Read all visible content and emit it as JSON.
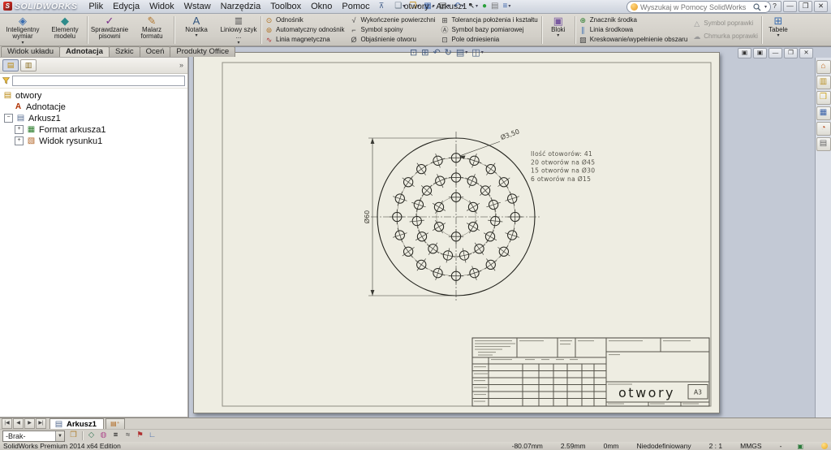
{
  "window": {
    "logo_text": "SOLIDWORKS",
    "logo_mark": "S",
    "title": "otwory - Arkusz1 *",
    "controls": [
      {
        "name": "help-button",
        "glyph": "?"
      },
      {
        "name": "minimize-button",
        "glyph": "—"
      },
      {
        "name": "restore-button",
        "glyph": "❐"
      },
      {
        "name": "close-button",
        "glyph": "✕"
      }
    ]
  },
  "menubar": {
    "items": [
      {
        "name": "plik",
        "label": "Plik"
      },
      {
        "name": "edycja",
        "label": "Edycja"
      },
      {
        "name": "widok",
        "label": "Widok"
      },
      {
        "name": "wstaw",
        "label": "Wstaw"
      },
      {
        "name": "narzedzia",
        "label": "Narzędzia"
      },
      {
        "name": "toolbox",
        "label": "Toolbox"
      },
      {
        "name": "okno",
        "label": "Okno"
      },
      {
        "name": "pomoc",
        "label": "Pomoc"
      }
    ]
  },
  "quick_access": {
    "icons": [
      {
        "name": "new-document",
        "glyph": "❏",
        "color": "#5a6a7a",
        "caret": true
      },
      {
        "name": "open-document",
        "glyph": "❒",
        "color": "#c9921f",
        "caret": true
      },
      {
        "name": "save-document",
        "glyph": "▦",
        "color": "#3a62a8",
        "caret": true
      },
      {
        "name": "print-document",
        "glyph": "▤",
        "color": "#555555",
        "caret": true
      },
      {
        "name": "undo",
        "glyph": "↶",
        "color": "#3a62a8",
        "caret": true
      },
      {
        "name": "select-arrow",
        "glyph": "↖",
        "color": "#222222",
        "caret": true
      },
      {
        "name": "rebuild",
        "glyph": "●",
        "color": "#2aa03a",
        "caret": false
      },
      {
        "name": "file-properties",
        "glyph": "▤",
        "color": "#777777",
        "caret": false
      },
      {
        "name": "options-list",
        "glyph": "≡",
        "color": "#3a62a8",
        "caret": true
      }
    ]
  },
  "search": {
    "placeholder": "Wyszukaj w Pomocy SolidWorks"
  },
  "ribbon": {
    "groups": [
      {
        "type": "big",
        "items": [
          {
            "name": "inteligentny-wymiar",
            "label": "Inteligentny wymiar",
            "glyph": "◈",
            "color": "#3a6db0",
            "caret": true
          },
          {
            "name": "elementy-modelu",
            "label": "Elementy modelu",
            "glyph": "◆",
            "color": "#2e8b8b",
            "caret": false
          }
        ]
      },
      {
        "type": "sep"
      },
      {
        "type": "big",
        "items": [
          {
            "name": "sprawdzanie-pisowni",
            "label": "Sprawdzanie pisowni",
            "glyph": "✓",
            "color": "#7a2e8b",
            "caret": false
          },
          {
            "name": "malarz-formatu",
            "label": "Malarz formatu",
            "glyph": "✎",
            "color": "#b0762e",
            "caret": false
          }
        ]
      },
      {
        "type": "sep"
      },
      {
        "type": "big",
        "items": [
          {
            "name": "notatka",
            "label": "Notatka",
            "glyph": "A",
            "color": "#33557f",
            "caret": true
          },
          {
            "name": "liniowy-szyk",
            "label": "Liniowy szyk ...",
            "glyph": "≣",
            "color": "#555555",
            "caret": true
          }
        ]
      },
      {
        "type": "sep"
      },
      {
        "type": "list",
        "items": [
          {
            "name": "odnosnik",
            "label": "Odnośnik",
            "glyph": "⊙",
            "color": "#b07020"
          },
          {
            "name": "automatyczny-odnosnik",
            "label": "Automatyczny odnośnik",
            "glyph": "⊚",
            "color": "#b07020"
          },
          {
            "name": "linia-magnetyczna",
            "label": "Linia magnetyczna",
            "glyph": "∿",
            "color": "#b03030"
          }
        ]
      },
      {
        "type": "list",
        "items": [
          {
            "name": "wykonczenie-powierzchni",
            "label": "Wykończenie powierzchni",
            "glyph": "√",
            "color": "#444444"
          },
          {
            "name": "symbol-spoiny",
            "label": "Symbol spoiny",
            "glyph": "⌐",
            "color": "#444444"
          },
          {
            "name": "objasnienie-otworu",
            "label": "Objaśnienie otworu",
            "glyph": "Ø",
            "color": "#444444"
          }
        ]
      },
      {
        "type": "list",
        "items": [
          {
            "name": "tolerancja-polozenia-i-ksztaltu",
            "label": "Tolerancja położenia i kształtu",
            "glyph": "⊞",
            "color": "#444444"
          },
          {
            "name": "symbol-bazy-pomiarowej",
            "label": "Symbol bazy pomiarowej",
            "glyph": "Ⓐ",
            "color": "#444444"
          },
          {
            "name": "pole-odniesienia",
            "label": "Pole odniesienia",
            "glyph": "⊡",
            "color": "#444444"
          }
        ]
      },
      {
        "type": "sep"
      },
      {
        "type": "big",
        "narrow": true,
        "items": [
          {
            "name": "bloki",
            "label": "Bloki",
            "glyph": "▣",
            "color": "#7a5aa0",
            "caret": true
          }
        ]
      },
      {
        "type": "sep"
      },
      {
        "type": "list",
        "items": [
          {
            "name": "znacznik-srodka",
            "label": "Znacznik środka",
            "glyph": "⊕",
            "color": "#2d7d2d"
          },
          {
            "name": "linia-srodkowa",
            "label": "Linia środkowa",
            "glyph": "∥",
            "color": "#3a6db0"
          },
          {
            "name": "kreskowanie-wypelnienie",
            "label": "Kreskowanie/wypełnienie obszaru",
            "glyph": "▨",
            "color": "#444444"
          }
        ]
      },
      {
        "type": "list",
        "items": [
          {
            "name": "symbol-poprawki",
            "label": "Symbol poprawki",
            "glyph": "△",
            "color": "#999999",
            "disabled": true
          },
          {
            "name": "chmurka-poprawki",
            "label": "Chmurka poprawki",
            "glyph": "☁",
            "color": "#999999",
            "disabled": true
          }
        ]
      },
      {
        "type": "sep"
      },
      {
        "type": "big",
        "narrow": true,
        "items": [
          {
            "name": "tabele",
            "label": "Tabele",
            "glyph": "⊞",
            "color": "#3a6db0",
            "caret": true
          }
        ]
      }
    ]
  },
  "command_tabs": {
    "items": [
      {
        "name": "widok-ukladu",
        "label": "Widok układu",
        "active": false
      },
      {
        "name": "adnotacja",
        "label": "Adnotacja",
        "active": true
      },
      {
        "name": "szkic",
        "label": "Szkic",
        "active": false
      },
      {
        "name": "ocen",
        "label": "Oceń",
        "active": false
      },
      {
        "name": "produkty-office",
        "label": "Produkty Office",
        "active": false
      }
    ]
  },
  "feature_tree": {
    "items": [
      {
        "name": "tree-root-otwory",
        "label": "otwory",
        "level": 0,
        "expander": null,
        "icon": {
          "glyph": "▤",
          "color": "#b8860b"
        }
      },
      {
        "name": "tree-adnotacje",
        "label": "Adnotacje",
        "level": 1,
        "expander": null,
        "icon": {
          "glyph": "A",
          "color": "#b03000"
        }
      },
      {
        "name": "tree-arkusz1",
        "label": "Arkusz1",
        "level": 1,
        "expander": "minus",
        "icon": {
          "glyph": "▤",
          "color": "#556b8f"
        }
      },
      {
        "name": "tree-format-arkusza1",
        "label": "Format arkusza1",
        "level": 2,
        "expander": "plus",
        "icon": {
          "glyph": "▦",
          "color": "#2d7d2d"
        }
      },
      {
        "name": "tree-widok-rysunku1",
        "label": "Widok rysunku1",
        "level": 2,
        "expander": "plus",
        "icon": {
          "glyph": "▧",
          "color": "#b06020"
        }
      }
    ]
  },
  "headsup": {
    "icons": [
      {
        "name": "zoom-to-fit",
        "glyph": "⊡",
        "caret": false
      },
      {
        "name": "zoom-to-area",
        "glyph": "⊞",
        "caret": false
      },
      {
        "name": "previous-view",
        "glyph": "↶",
        "caret": false
      },
      {
        "name": "rotate-view",
        "glyph": "↻",
        "caret": false
      },
      {
        "name": "view-settings",
        "glyph": "▤",
        "caret": true
      },
      {
        "name": "display-style",
        "glyph": "◫",
        "caret": true
      }
    ]
  },
  "doc_controls": [
    {
      "name": "doc-window-icon-1",
      "glyph": "▣"
    },
    {
      "name": "doc-window-icon-2",
      "glyph": "▣"
    },
    {
      "name": "doc-minimize-button",
      "glyph": "—"
    },
    {
      "name": "doc-restore-button",
      "glyph": "❐"
    },
    {
      "name": "doc-close-button",
      "glyph": "✕"
    }
  ],
  "task_pane": {
    "icons": [
      {
        "name": "solidworks-resources",
        "glyph": "⌂",
        "color": "#c06820"
      },
      {
        "name": "design-library",
        "glyph": "▥",
        "color": "#b8912a"
      },
      {
        "name": "file-explorer",
        "glyph": "❒",
        "color": "#caa11f"
      },
      {
        "name": "view-palette",
        "glyph": "▦",
        "color": "#3a62a8"
      },
      {
        "name": "appearances-scenes",
        "glyph": "◔",
        "color": "#b84a20"
      },
      {
        "name": "custom-properties",
        "glyph": "▤",
        "color": "#666666"
      }
    ]
  },
  "drawing": {
    "dim_plate": "Ø60",
    "dim_hole": "Ø3,50",
    "notes": [
      "Ilość otoworów: 41",
      "20 otworów na  Ø45",
      "15 otworów na  Ø30",
      "6  otworów na  Ø15"
    ],
    "plate_diameter_mm": 60,
    "hole_diameter_mm": 3.5,
    "rings": [
      {
        "count": 20,
        "bolt_circle_mm": 45
      },
      {
        "count": 15,
        "bolt_circle_mm": 30
      },
      {
        "count": 6,
        "bolt_circle_mm": 15
      }
    ]
  },
  "title_block": {
    "title": "otwory",
    "format": "A3"
  },
  "sheet_tabs": {
    "active": "Arkusz1"
  },
  "layer_bar": {
    "layer_value": "-Brak-",
    "icons": [
      {
        "name": "layer-properties",
        "glyph": "❒",
        "color": "#b08030"
      },
      {
        "name": "sep"
      },
      {
        "name": "line-color",
        "glyph": "◇",
        "color": "#3a7a5a"
      },
      {
        "name": "assembly-visualization",
        "glyph": "◍",
        "color": "#b05090"
      },
      {
        "name": "line-thickness",
        "glyph": "≡",
        "color": "#111111"
      },
      {
        "name": "line-style",
        "glyph": "≈",
        "color": "#333333"
      },
      {
        "name": "hide-show-annotations",
        "glyph": "⚑",
        "color": "#b03030"
      },
      {
        "name": "color-display-mode",
        "glyph": "∟",
        "color": "#3a62a8"
      }
    ]
  },
  "status_bar": {
    "app": "SolidWorks Premium 2014 x64 Edition",
    "fields": [
      {
        "name": "status-coord-x",
        "label": "-80.07mm"
      },
      {
        "name": "status-coord-y",
        "label": "2.59mm"
      },
      {
        "name": "status-coord-z",
        "label": "0mm"
      },
      {
        "name": "status-constraint-state",
        "label": "Niedodefiniowany"
      },
      {
        "name": "status-sheet-scale",
        "label": "2 : 1"
      },
      {
        "name": "status-units",
        "label": "MMGS"
      },
      {
        "name": "status-units-caret",
        "label": "-"
      }
    ]
  }
}
